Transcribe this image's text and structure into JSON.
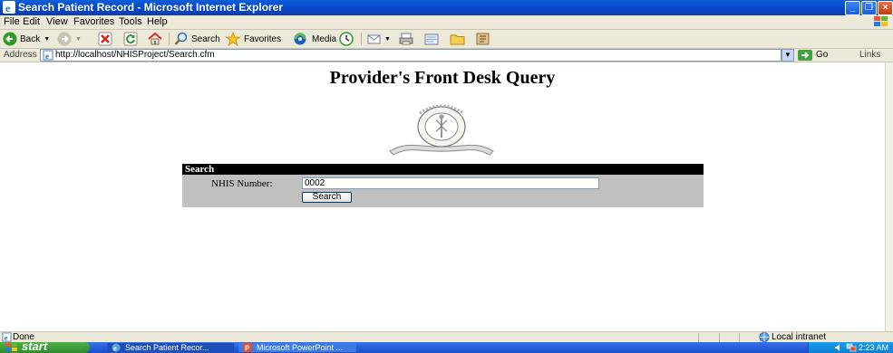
{
  "window": {
    "title": "Search Patient Record - Microsoft Internet Explorer"
  },
  "menu": [
    "File",
    "Edit",
    "View",
    "Favorites",
    "Tools",
    "Help"
  ],
  "toolbar": {
    "back_label": "Back",
    "search_label": "Search",
    "favorites_label": "Favorites",
    "media_label": "Media"
  },
  "address": {
    "label": "Address",
    "url": "http://localhost/NHISProject/Search.cfm",
    "go_label": "Go",
    "links_label": "Links"
  },
  "page": {
    "title": "Provider's Front Desk Query",
    "search_panel": {
      "header": "Search",
      "nhis_label": "NHIS Number:",
      "nhis_value": "0002",
      "button_label": "Search"
    }
  },
  "status": {
    "text": "Done",
    "zone": "Local intranet"
  },
  "taskbar": {
    "start_label": "start",
    "tasks": [
      "Search Patient Recor...",
      "Microsoft PowerPoint ..."
    ],
    "clock": "2:23 AM"
  },
  "colors": {
    "titlebar": "#0a47c6",
    "panel_bg": "#c0c0c0",
    "panel_header": "#000000",
    "taskbar": "#245edb",
    "start_green": "#2f8c2b"
  }
}
